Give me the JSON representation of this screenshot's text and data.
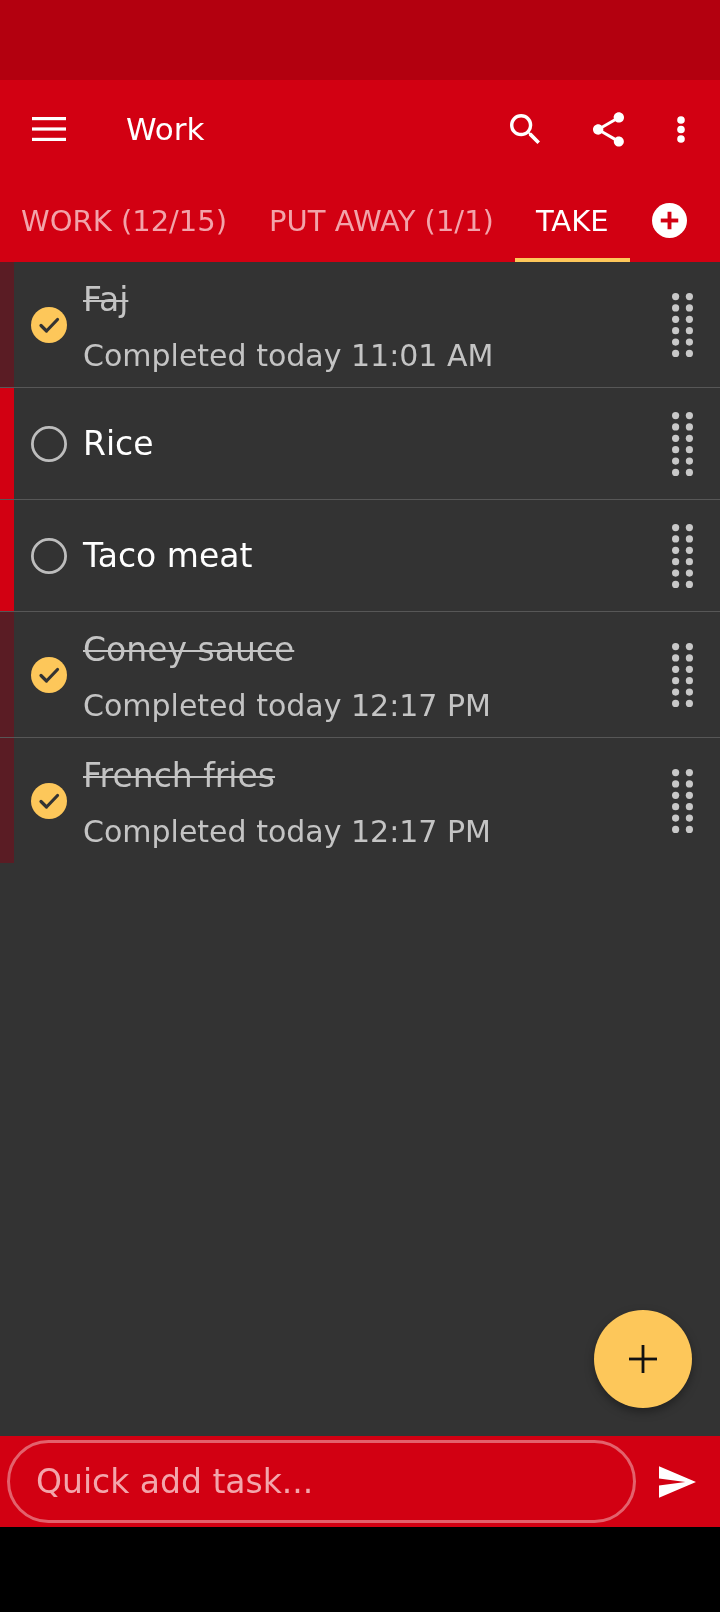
{
  "toolbar": {
    "title": "Work"
  },
  "tabs": [
    {
      "label": "WORK (12/15)",
      "selected": false
    },
    {
      "label": "PUT AWAY (1/1)",
      "selected": false
    },
    {
      "label": "TAKE",
      "selected": true
    }
  ],
  "tasks": [
    {
      "title": "Faj",
      "completed": true,
      "note": "Completed today 11:01 AM"
    },
    {
      "title": "Rice",
      "completed": false
    },
    {
      "title": "Taco meat",
      "completed": false
    },
    {
      "title": "Coney sauce",
      "completed": true,
      "note": "Completed today 12:17 PM"
    },
    {
      "title": "French fries",
      "completed": true,
      "note": "Completed today 12:17 PM"
    }
  ],
  "quick_add": {
    "placeholder": "Quick add task..."
  }
}
